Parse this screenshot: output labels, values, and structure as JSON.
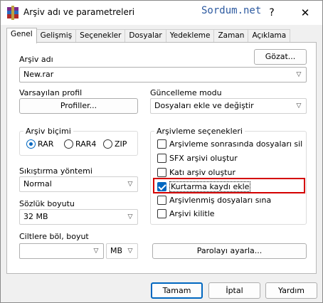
{
  "window": {
    "title": "Arşiv adı ve parametreleri",
    "watermark": "Sordum.net",
    "help": "?",
    "close": "✕"
  },
  "tabs": [
    {
      "label": "Genel",
      "active": true
    },
    {
      "label": "Gelişmiş"
    },
    {
      "label": "Seçenekler"
    },
    {
      "label": "Dosyalar"
    },
    {
      "label": "Yedekleme"
    },
    {
      "label": "Zaman"
    },
    {
      "label": "Açıklama"
    }
  ],
  "archive": {
    "name_label": "Arşiv adı",
    "browse_label": "Gözat...",
    "name_value": "New.rar"
  },
  "profile": {
    "label": "Varsayılan profil",
    "button": "Profiller..."
  },
  "update": {
    "label": "Güncelleme modu",
    "value": "Dosyaları ekle ve değiştir"
  },
  "format": {
    "label": "Arşiv biçimi",
    "options": [
      "RAR",
      "RAR4",
      "ZIP"
    ],
    "selected": "RAR"
  },
  "compression": {
    "label": "Sıkıştırma yöntemi",
    "value": "Normal"
  },
  "dictionary": {
    "label": "Sözlük boyutu",
    "value": "32 MB"
  },
  "split": {
    "label": "Ciltlere böl, boyut",
    "value": "",
    "unit": "MB"
  },
  "options": {
    "label": "Arşivleme seçenekleri",
    "items": [
      {
        "label": "Arşivleme sonrasında dosyaları sil",
        "checked": false
      },
      {
        "label": "SFX arşivi oluştur",
        "checked": false
      },
      {
        "label": "Katı arşiv oluştur",
        "checked": false
      },
      {
        "label": "Kurtarma kaydı ekle",
        "checked": true
      },
      {
        "label": "Arşivlenmiş dosyaları sına",
        "checked": false
      },
      {
        "label": "Arşivi kilitle",
        "checked": false
      }
    ]
  },
  "password_button": "Parolayı ayarla...",
  "footer": {
    "ok": "Tamam",
    "cancel": "İptal",
    "help": "Yardım"
  },
  "colors": {
    "accent": "#0067c0",
    "highlight": "#d40000",
    "watermark": "#2d5aa0"
  }
}
